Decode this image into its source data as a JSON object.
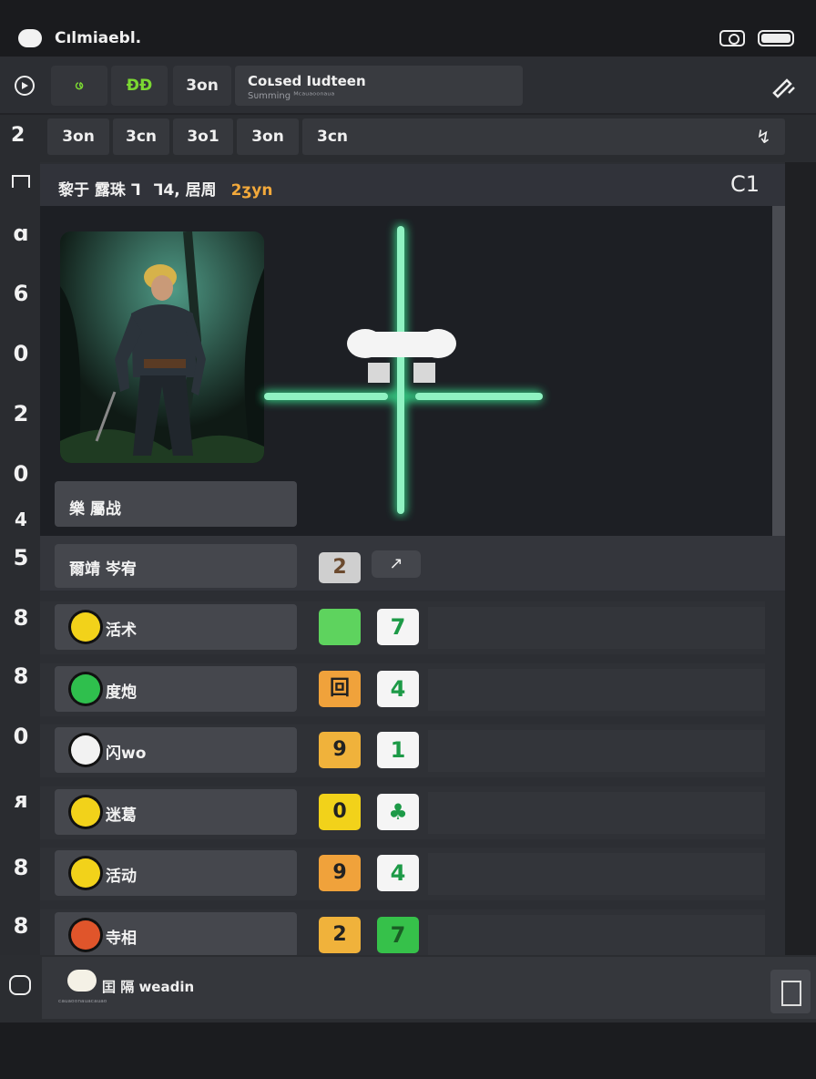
{
  "status_bar": {
    "title": "Cılmiaebl."
  },
  "toolbar": {
    "green_btn_1": "ဖ",
    "green_btn_2": "ĐĐ",
    "btn_3": "3on",
    "search_title": "Cᴏʟsed Iudteen",
    "search_subtitle": "Sᴜmming ᴹᶜᵃᵘᵃᵒᵒⁿᵃᵘᵃ"
  },
  "tabs": {
    "row_number": "2",
    "items": [
      "3on",
      "3ᴄn",
      "3ᴏ1",
      "3on",
      "3ᴄn"
    ],
    "right_icon": "↯"
  },
  "rail": [
    "ɑ",
    "6",
    "0",
    "2",
    "0",
    "4",
    "5",
    "8",
    "8",
    "0",
    "ᴙ",
    "8",
    "8"
  ],
  "header": {
    "text": "黎于 露珠  Ꞁ",
    "mid": "Ꞁ4, 居周",
    "accent": "2ʒyn",
    "right": "C1"
  },
  "character": {
    "name": "樂 屬战"
  },
  "stats_header": {
    "label": "爾靖 岑宥",
    "btn1": "2",
    "btn2": "↗"
  },
  "rows": [
    {
      "label": "活术",
      "gem_color": "#f2d21a",
      "b1": "",
      "b1_color": "#5ed35e",
      "b2": "7"
    },
    {
      "label": "度炮",
      "gem_color": "#2fbf4d",
      "b1": "回",
      "b1_color": "#f0a23b",
      "b2": "4"
    },
    {
      "label": "闪wo",
      "gem_color": "#f2f2f2",
      "b1": "9",
      "b1_color": "#f0b23b",
      "b2": "1"
    },
    {
      "label": "迷葛",
      "gem_color": "#f2d21a",
      "b1": "0",
      "b1_color": "#f2d21a",
      "b2": "♣"
    },
    {
      "label": "活动",
      "gem_color": "#f2d21a",
      "b1": "9",
      "b1_color": "#f0a23b",
      "b2": "4"
    },
    {
      "label": "寺相",
      "gem_color": "#e0552b",
      "b1": "2",
      "b1_color": "#f0b23b",
      "b2": "7",
      "b2_green_bg": true
    }
  ],
  "footer": {
    "title": "囯 隔 ᴡeadin",
    "subtitle": "ᶜᵃᵘᵃᵒᵒⁿᵃᵘᵃᶜᵃᵘᵃᵒ"
  },
  "colors": {
    "accent_green": "#7bd832",
    "glow_green": "#4fe3a0",
    "accent_orange": "#f2a93b"
  },
  "icons": [
    "play-icon",
    "edit-icon",
    "camera-icon",
    "battery-icon",
    "crosshair-icon"
  ]
}
